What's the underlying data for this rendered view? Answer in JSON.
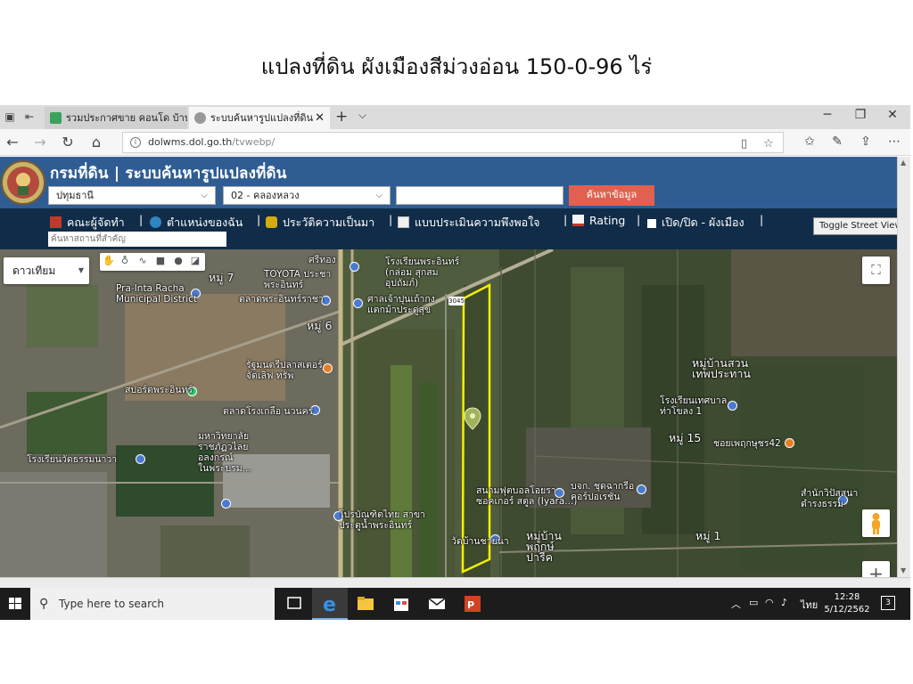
{
  "slide": {
    "title": "แปลงที่ดิน ผังเมืองสีม่วงอ่อน 150-0-96 ไร่"
  },
  "browser": {
    "tabs": [
      {
        "label": "รวมประกาศขาย คอนโด บ้าน ที่ดิ",
        "active": false
      },
      {
        "label": "ระบบค้นหารูปแปลงที่ดิน",
        "active": true
      }
    ],
    "url_host": "dolwms.dol.go.th",
    "url_path": "/tvwebp/"
  },
  "site": {
    "title": "กรมที่ดิน | ระบบค้นหารูปแปลงที่ดิน",
    "province_select": "ปทุมธานี",
    "district_select": "02 - คลองหลวง",
    "parcel_input": "",
    "search_button": "ค้นหาข้อมูล",
    "menu": [
      {
        "label": "คณะผู้จัดทำ",
        "icon": "team-icon"
      },
      {
        "label": "ตำแหน่งของฉัน",
        "icon": "globe-icon"
      },
      {
        "label": "ประวัติความเป็นมา",
        "icon": "history-icon"
      },
      {
        "label": "แบบประเมินความพึงพอใจ",
        "icon": "form-icon"
      },
      {
        "label": "Rating",
        "icon": "rating-icon"
      },
      {
        "label": "เปิด/ปิด - ผังเมือง",
        "icon": "checkbox-icon"
      }
    ],
    "place_search_placeholder": "ค้นหาสถานที่สำคัญ",
    "toggle_street_view": "Toggle Street View"
  },
  "map": {
    "type_select": "ดาวเทียม",
    "road_number": "3045",
    "labels": [
      {
        "text": "หมู่ 7"
      },
      {
        "text": "Pra-Inta Racha\nMunicipal District"
      },
      {
        "text": "TOYOTA ประชา\nพระอินทร์"
      },
      {
        "text": "ตลาดพระอินทร์ราชา"
      },
      {
        "text": "ศรีทอง"
      },
      {
        "text": "โรงเรียนพระอินทร์\n(กล่อม สุกสม\nอุปถัมภ์)"
      },
      {
        "text": "ศาลเจ้าปุนเถ้ากง\nแตกม้าประดู่สุข"
      },
      {
        "text": "หมู่ 6"
      },
      {
        "text": "รัฐมนตรีปลาสเตอร์\nจัดเลิฟ ทรัพ"
      },
      {
        "text": "สปอร์ตพระอินทร์"
      },
      {
        "text": "ตลาดโรงเกลือ นวนคร"
      },
      {
        "text": "โรงเรียนวัดธรรมนาวา"
      },
      {
        "text": "มหาวิทยาลัย\nราชภัฏวไลย\nอลงกรณ์\nในพระบรม..."
      },
      {
        "text": "โปรบัณฑิตไทย สาขา\nประตูน้ำพระอินทร์"
      },
      {
        "text": "สนามฟุตบอลโอยรา\nซอคเกอร์ สตูล (Iyara...)"
      },
      {
        "text": "วัดบ้านชายนา"
      },
      {
        "text": "หมู่บ้าน\nพฤกษ์\nปารีค"
      },
      {
        "text": "บจก. ชุดฉากรีอ\nคอร์ปอเรชั่น"
      },
      {
        "text": "หมู่บ้านสวน\nเทพประทาน"
      },
      {
        "text": "โรงเรียนเทศบาล\nท่าโขลง 1"
      },
      {
        "text": "หมู่ 15"
      },
      {
        "text": "ชอยเพฤกษุชร42"
      },
      {
        "text": "หมู่ 1"
      },
      {
        "text": "สำนักวิปัสสนา\nดำรงธรรม"
      }
    ]
  },
  "taskbar": {
    "search_placeholder": "Type here to search",
    "language": "ไทย",
    "time": "12:28",
    "date": "5/12/2562",
    "notification_count": "3"
  },
  "colors": {
    "header_blue": "#2f5d93",
    "menu_navy": "#102c48",
    "search_button": "#e2604f",
    "parcel_outline": "#f5f000"
  }
}
